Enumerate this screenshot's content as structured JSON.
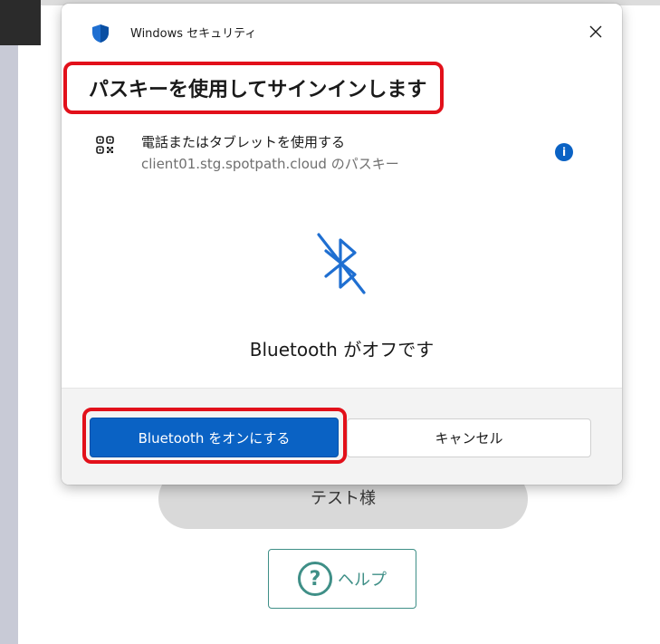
{
  "background": {
    "user_name": "テスト様",
    "help_label": "ヘルプ",
    "help_glyph": "?"
  },
  "dialog": {
    "window_title": "Windows セキュリティ",
    "close_glyph": "✕",
    "heading": "パスキーを使用してサインインします",
    "option": {
      "title": "電話またはタブレットを使用する",
      "subtitle": "client01.stg.spotpath.cloud のパスキー",
      "info_glyph": "i"
    },
    "status": "Bluetooth がオフです",
    "buttons": {
      "primary": "Bluetooth をオンにする",
      "secondary": "キャンセル"
    }
  },
  "colors": {
    "accent_blue": "#0a62c4",
    "highlight_red": "#e2101a",
    "help_teal": "#3f8f87"
  },
  "icons": {
    "shield": "shield-icon",
    "close": "close-icon",
    "qr": "qr-code-icon",
    "info": "info-icon",
    "bluetooth_off": "bluetooth-off-icon",
    "help": "question-circle-icon"
  }
}
